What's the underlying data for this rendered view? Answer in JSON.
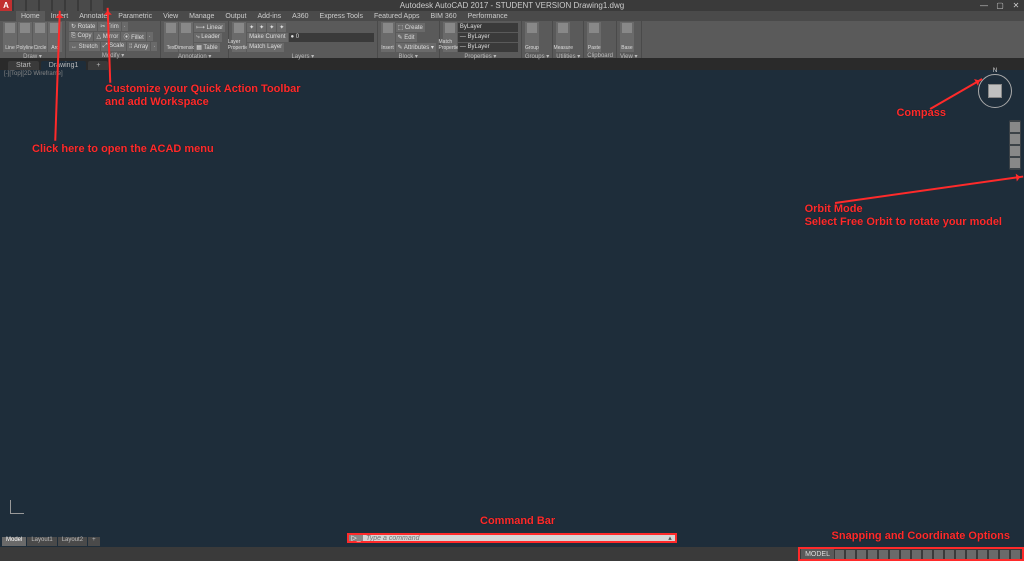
{
  "title": "Autodesk AutoCAD 2017 - STUDENT VERSION   Drawing1.dwg",
  "app_icon_letter": "A",
  "qat_count": 7,
  "win": {
    "min": "—",
    "max": "▢",
    "close": "✕"
  },
  "ribbon_tabs": [
    "Home",
    "Insert",
    "Annotate",
    "Parametric",
    "View",
    "Manage",
    "Output",
    "Add-ins",
    "A360",
    "Express Tools",
    "Featured Apps",
    "BIM 360",
    "Performance"
  ],
  "ribbon_active": 0,
  "panels": {
    "draw": {
      "title": "Draw ▾",
      "big": [
        "Line",
        "Polyline",
        "Circle",
        "Arc"
      ],
      "small": [
        ""
      ]
    },
    "modify": {
      "title": "Modify ▾",
      "rows": [
        [
          "↻ Rotate",
          "✂ Trim",
          "·"
        ],
        [
          "⎘ Copy",
          "△ Mirror",
          "⦿ Fillet",
          "·"
        ],
        [
          "↔ Stretch",
          "⤢ Scale",
          "⁞⁞ Array",
          "·"
        ]
      ]
    },
    "annotation": {
      "title": "Annotation ▾",
      "big": [
        "Text",
        "Dimension"
      ],
      "rows": [
        [
          "⟼ Linear"
        ],
        [
          "⤷ Leader"
        ],
        [
          "▦ Table"
        ]
      ]
    },
    "layers": {
      "title": "Layers ▾",
      "big": [
        "Layer Properties"
      ],
      "combo": "● 0",
      "rows": [
        [
          "✦",
          "✦",
          "✦",
          "✦"
        ],
        [
          "Make Current"
        ],
        [
          "Match Layer"
        ]
      ]
    },
    "block": {
      "title": "Block ▾",
      "big": [
        "Insert"
      ],
      "rows": [
        [
          "⬚ Create"
        ],
        [
          "✎ Edit"
        ],
        [
          "✎ Attributes ▾"
        ]
      ]
    },
    "properties": {
      "title": "Properties ▾",
      "big": [
        "Match Properties"
      ],
      "combos": [
        "ByLayer",
        "— ByLayer",
        "— ByLayer"
      ]
    },
    "groups": {
      "title": "Groups ▾",
      "big": [
        "Group"
      ]
    },
    "utilities": {
      "title": "Utilities ▾",
      "big": [
        "Measure"
      ]
    },
    "clipboard": {
      "title": "Clipboard",
      "big": [
        "Paste"
      ]
    },
    "view": {
      "title": "View ▾",
      "big": [
        "Base"
      ]
    }
  },
  "file_tabs": [
    "Start",
    "Drawing1"
  ],
  "file_tab_active": 1,
  "viewport_label": "[-][Top][2D Wireframe]",
  "compass_n": "N",
  "layout_tabs": [
    "Model",
    "Layout1",
    "Layout2"
  ],
  "layout_active": 0,
  "cmd_placeholder": "Type a command",
  "cmd_prefix": "▷_",
  "status": {
    "model": "MODEL",
    "icons_count": 17
  },
  "annotations": {
    "acad_menu": "Click here to open the ACAD menu",
    "qat": "Customize your Quick Action Toolbar\nand add Workspace",
    "compass": "Compass",
    "orbit": "Orbit Mode\nSelect Free Orbit to rotate your model",
    "cmdbar": "Command Bar",
    "snap": "Snapping and Coordinate Options"
  }
}
